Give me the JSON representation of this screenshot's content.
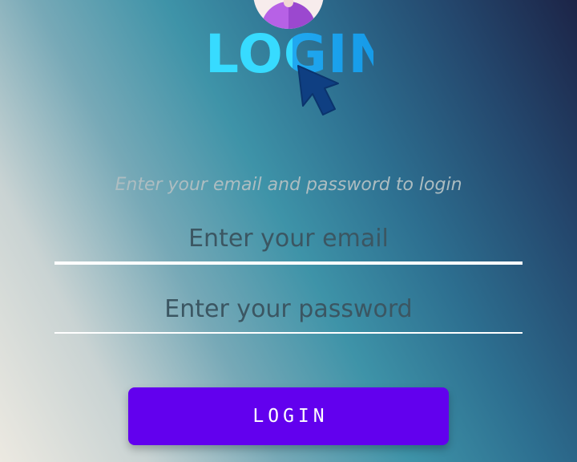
{
  "header": {
    "logo_text": "LOGIN",
    "icons": {
      "avatar": "avatar-icon",
      "cursor": "cursor-icon"
    },
    "colors": {
      "logo_primary": "#37dbff",
      "logo_secondary": "#20a8f0",
      "avatar_primary": "#b761e6",
      "cursor": "#0f3f82"
    }
  },
  "form": {
    "subtitle": "Enter your email and password to login",
    "email": {
      "value": "",
      "placeholder": "Enter your email"
    },
    "password": {
      "value": "",
      "placeholder": "Enter your password"
    },
    "login_button": "LOGIN",
    "colors": {
      "button": "#6200ee",
      "button_text": "#ffffff",
      "field_line": "#ffffff"
    }
  }
}
